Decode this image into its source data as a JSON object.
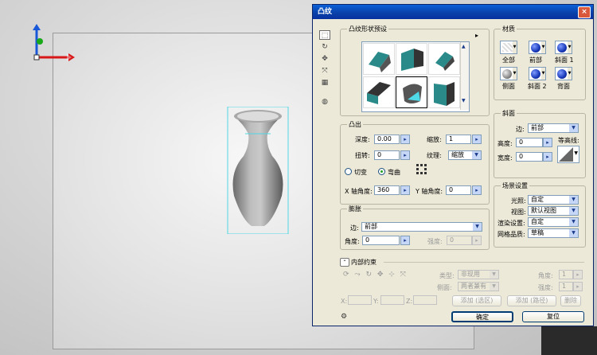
{
  "dialog": {
    "title": "凸纹",
    "close_symbol": "×"
  },
  "presets": {
    "group_title": "凸纹形状预设",
    "menu_symbol": "▸"
  },
  "extrude": {
    "group_title": "凸出",
    "depth_label": "深度:",
    "depth_value": "0.00",
    "scale_label": "缩放:",
    "scale_value": "1",
    "twist_label": "扭转:",
    "twist_value": "0",
    "texture_label": "纹理:",
    "texture_value": "缩放",
    "radio_cut_label": "切变",
    "radio_bend_label": "弯曲",
    "x_angle_label": "X 轴角度:",
    "x_angle_value": "360",
    "y_angle_label": "Y 轴角度:",
    "y_angle_value": "0"
  },
  "inflate": {
    "group_title": "膨胀",
    "side_label": "边:",
    "side_value": "前部",
    "angle_label": "角度:",
    "angle_value": "0",
    "strength_label": "强度:",
    "strength_value": "0"
  },
  "materials": {
    "group_title": "材质",
    "items": [
      {
        "label": "全部",
        "color": "#cfcfcf"
      },
      {
        "label": "前部",
        "color": "#1838b8"
      },
      {
        "label": "斜面 1",
        "color": "#1838b8"
      },
      {
        "label": "侧面",
        "color": "#8a8a8a"
      },
      {
        "label": "斜面 2",
        "color": "#1838b8"
      },
      {
        "label": "背面",
        "color": "#1838b8"
      }
    ]
  },
  "bevel": {
    "group_title": "斜面",
    "side_label": "边:",
    "side_value": "前部",
    "height_label": "高度:",
    "height_value": "0",
    "contour_label": "等高线:",
    "width_label": "宽度:",
    "width_value": "0"
  },
  "scene": {
    "group_title": "场景设置",
    "lighting_label": "光照:",
    "lighting_value": "自定",
    "view_label": "视图:",
    "view_value": "默认视图",
    "render_label": "渲染设置:",
    "render_value": "自定",
    "mesh_label": "网格品质:",
    "mesh_value": "草稿"
  },
  "constraints": {
    "title": "内部约束",
    "type_label": "类型:",
    "type_value": "非现用",
    "side_label": "侧面:",
    "side_value": "两者兼有",
    "angle_label": "角度:",
    "angle_value": "1",
    "strength_label": "强度:",
    "strength_value": "1",
    "x_label": "X:",
    "y_label": "Y:",
    "z_label": "Z:",
    "add_selection_label": "添加 (选区)",
    "add_path_label": "添加 (路径)",
    "delete_label": "删除"
  },
  "buttons": {
    "ok_label": "确定",
    "reset_label": "复位"
  },
  "colors": {
    "titlebar": "#0a3fa8",
    "dialog_bg": "#ece9d8",
    "accent_cyan": "#4fd8e6",
    "gizmo_red": "#d81818",
    "gizmo_blue": "#1858d8",
    "gizmo_green": "#18a818"
  }
}
